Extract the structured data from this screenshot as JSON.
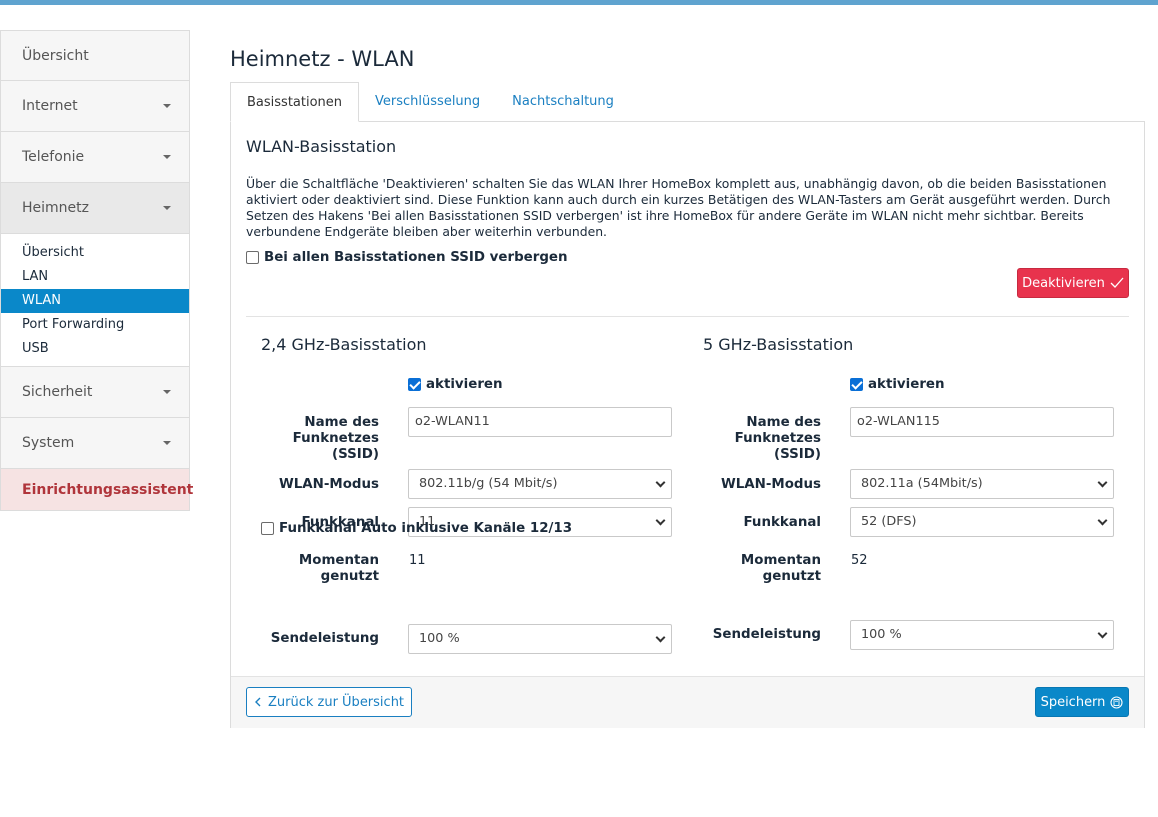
{
  "sidebar": {
    "items": [
      {
        "label": "Übersicht"
      },
      {
        "label": "Internet"
      },
      {
        "label": "Telefonie"
      },
      {
        "label": "Heimnetz"
      }
    ],
    "heimnetz_submenu": [
      "Übersicht",
      "LAN",
      "WLAN",
      "Port Forwarding",
      "USB"
    ],
    "active_sub": "WLAN",
    "items_after": [
      {
        "label": "Sicherheit"
      },
      {
        "label": "System"
      }
    ],
    "wizard": "Einrichtungsassistent"
  },
  "page": {
    "title": "Heimnetz - WLAN",
    "tabs": [
      "Basisstationen",
      "Verschlüsselung",
      "Nachtschaltung"
    ]
  },
  "panel": {
    "title": "WLAN-Basisstation",
    "description": "Über die Schaltfläche 'Deaktivieren' schalten Sie das WLAN Ihrer HomeBox komplett aus, unabhängig davon, ob die beiden Basisstationen aktiviert oder deaktiviert sind. Diese Funktion kann auch durch ein kurzes Betätigen des WLAN-Tasters am Gerät ausgeführt werden. Durch Setzen des Hakens 'Bei allen Basisstationen SSID verbergen' ist ihre HomeBox für andere Geräte im WLAN nicht mehr sichtbar. Bereits verbundene Endgeräte bleiben aber weiterhin verbunden.",
    "hide_ssid_label": "Bei allen Basisstationen SSID verbergen",
    "hide_ssid_checked": false,
    "deactivate_label": "Deaktivieren"
  },
  "station24": {
    "title": "2,4 GHz-Basisstation",
    "activate_label": "aktivieren",
    "activate_checked": true,
    "ssid_label": "Name des Funknetzes (SSID)",
    "ssid_value": "o2-WLAN11",
    "mode_label": "WLAN-Modus",
    "mode_value": "802.11b/g (54 Mbit/s)",
    "channel_label": "Funkkanal",
    "channel_value": "11",
    "current_label": "Momentan genutzt",
    "current_value": "11",
    "auto_channel_label": "Funkkanal Auto inklusive Kanäle 12/13",
    "auto_channel_checked": false,
    "power_label": "Sendeleistung",
    "power_value": "100 %"
  },
  "station5": {
    "title": "5 GHz-Basisstation",
    "activate_label": "aktivieren",
    "activate_checked": true,
    "ssid_label": "Name des Funknetzes (SSID)",
    "ssid_value": "o2-WLAN115",
    "mode_label": "WLAN-Modus",
    "mode_value": "802.11a (54Mbit/s)",
    "channel_label": "Funkkanal",
    "channel_value": "52 (DFS)",
    "current_label": "Momentan genutzt",
    "current_value": "52",
    "power_label": "Sendeleistung",
    "power_value": "100 %"
  },
  "footer": {
    "back_label": "Zurück zur Übersicht",
    "save_label": "Speichern"
  },
  "colors": {
    "accent": "#0a88c9",
    "danger": "#e8334d",
    "wizard_text": "#b0353b",
    "topbar": "#5fa3cf"
  }
}
